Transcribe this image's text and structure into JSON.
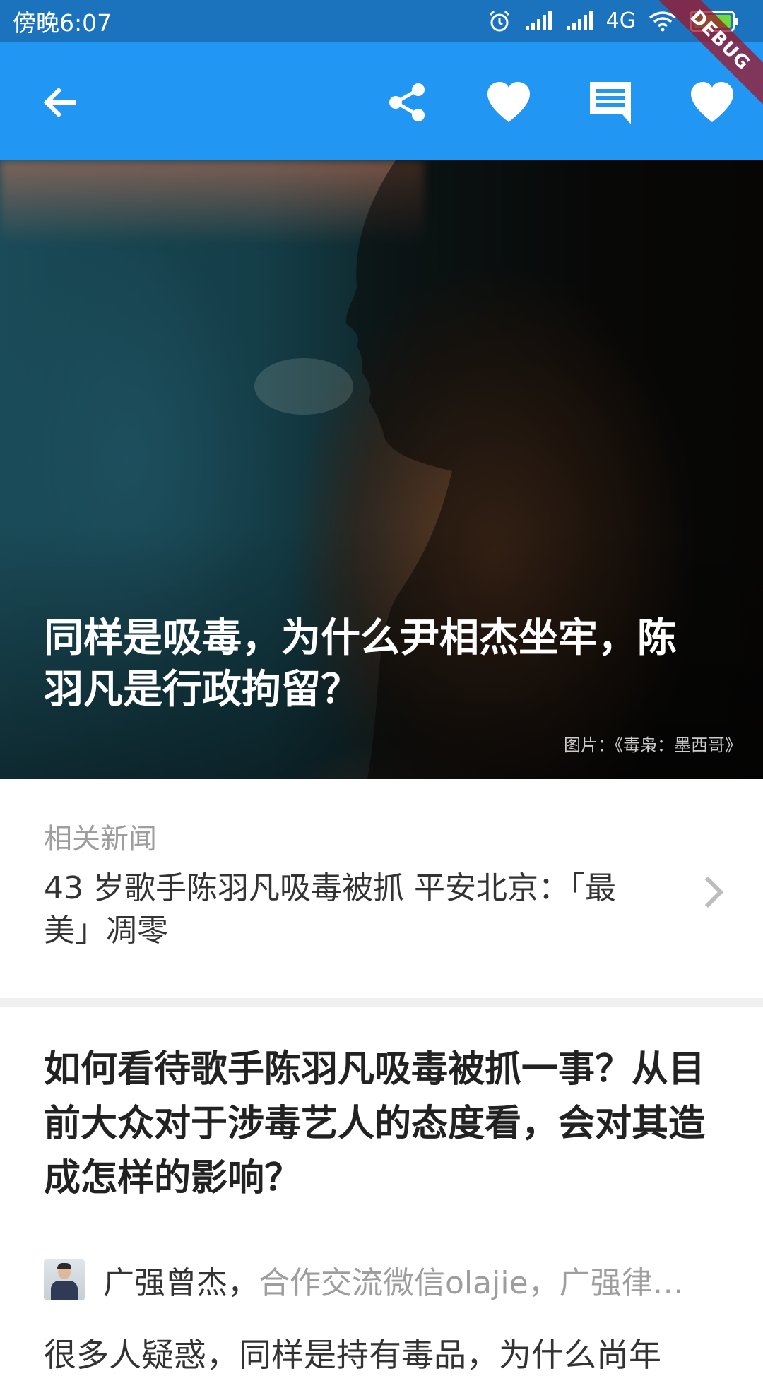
{
  "status_bar": {
    "time": "傍晚6:07",
    "network": "4G",
    "icons": [
      "alarm-icon",
      "signal-icon",
      "signal-icon",
      "wifi-icon",
      "battery-icon"
    ],
    "battery_color": "#6fdc3a"
  },
  "app_bar": {
    "color": "#2196f3",
    "actions": [
      "back-arrow-icon",
      "share-icon",
      "heart-icon",
      "comment-icon",
      "heart-icon"
    ]
  },
  "debug_banner": "DEBUG",
  "hero": {
    "title": "同样是吸毒，为什么尹相杰坐牢，陈羽凡是行政拘留？",
    "image_credit": "图片：《毒枭：墨西哥》"
  },
  "related_news": {
    "label": "相关新闻",
    "title": "43 岁歌手陈羽凡吸毒被抓 平安北京：「最美」凋零"
  },
  "question": {
    "title": "如何看待歌手陈羽凡吸毒被抓一事？从目前大众对于涉毒艺人的态度看，会对其造成怎样的影响？"
  },
  "answer": {
    "author_name": "广强曾杰，",
    "author_bio": "合作交流微信olajie，广强律…",
    "body_preview": "很多人疑惑，同样是持有毒品，为什么尚年"
  }
}
